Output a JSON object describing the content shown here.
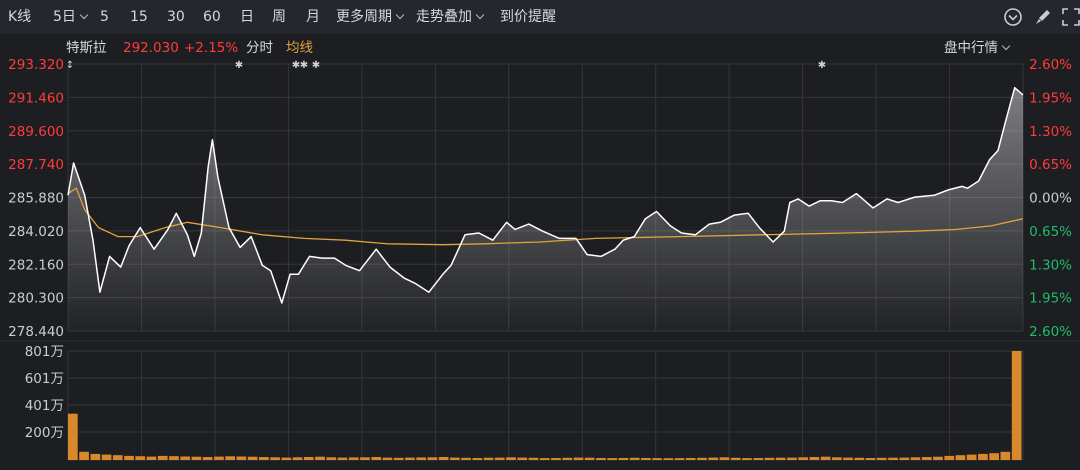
{
  "toolbar": {
    "items": [
      "K线",
      "5日",
      "5",
      "15",
      "30",
      "60",
      "日",
      "周",
      "月",
      "更多周期",
      "走势叠加",
      "到价提醒"
    ]
  },
  "info": {
    "name": "特斯拉",
    "price": "292.030",
    "change": "+2.15%",
    "mode": "分时",
    "avg_label": "均线",
    "right_menu": "盘中行情"
  },
  "colors": {
    "up": "#ff3b3b",
    "down": "#1fbd6a",
    "price_line": "#ffffff",
    "avg_line": "#e3a33c",
    "volume": "#d8892c",
    "grid": "#34363c",
    "text": "#c9ccd3"
  },
  "chart_data": [
    {
      "type": "line",
      "y_ticks": [
        "293.320",
        "291.460",
        "289.600",
        "287.740",
        "285.880",
        "284.020",
        "282.160",
        "280.300",
        "278.440"
      ],
      "pct_ticks": [
        "2.60%",
        "1.95%",
        "1.30%",
        "0.65%",
        "0.00%",
        "0.65%",
        "1.30%",
        "1.95%",
        "2.60%"
      ],
      "ylim": [
        278.44,
        293.32
      ],
      "reference": 285.88,
      "series": [
        {
          "kind": "price",
          "values": [
            286.0,
            287.8,
            286.0,
            283.5,
            280.6,
            282.6,
            282.0,
            283.2,
            284.2,
            283.0,
            284.1,
            285.0,
            283.8,
            282.6,
            283.9,
            287.6,
            289.1,
            287.0,
            284.2,
            283.1,
            283.7,
            282.1,
            281.8,
            280.0,
            281.6,
            281.6,
            282.6,
            282.5,
            282.5,
            282.1,
            281.8,
            283.0,
            282.0,
            281.4,
            281.1,
            280.6,
            281.6,
            282.1,
            283.8,
            283.9,
            283.5,
            284.5,
            284.1,
            284.4,
            284.0,
            283.6,
            283.6,
            282.7,
            282.6,
            283.0,
            283.5,
            283.7,
            284.7,
            285.1,
            284.3,
            283.9,
            283.8,
            284.4,
            284.5,
            284.9,
            285.0,
            284.2,
            283.4,
            284.0,
            285.6,
            285.8,
            285.4,
            285.7,
            285.7,
            285.6,
            286.1,
            285.3,
            285.8,
            285.6,
            285.9,
            286.0,
            286.3,
            286.5,
            286.4,
            286.8,
            288.0,
            288.5,
            290.0,
            292.0,
            291.6
          ],
          "x": [
            0,
            0.4,
            1.2,
            1.8,
            2.3,
            3.0,
            3.8,
            4.4,
            5.2,
            6.2,
            7.2,
            7.8,
            8.6,
            9.1,
            9.6,
            10.1,
            10.4,
            10.8,
            11.6,
            12.4,
            13.2,
            14.0,
            14.6,
            15.4,
            16.0,
            16.6,
            17.4,
            18.3,
            19.2,
            20.0,
            21.0,
            22.2,
            23.2,
            24.2,
            25.0,
            26.0,
            27.0,
            27.6,
            28.6,
            29.6,
            30.6,
            31.6,
            32.2,
            33.2,
            34.2,
            35.4,
            36.6,
            37.4,
            38.4,
            39.4,
            40.0,
            40.8,
            41.6,
            42.4,
            43.4,
            44.2,
            45.2,
            46.2,
            47.0,
            48.0,
            49.0,
            49.8,
            50.8,
            51.6,
            52.0,
            52.6,
            53.4,
            54.2,
            55.0,
            55.8,
            56.8,
            58.0,
            59.0,
            59.8,
            61.0,
            62.4,
            63.4,
            64.4,
            64.8,
            65.6,
            66.4,
            67.0,
            67.5,
            68.2,
            68.8
          ]
        },
        {
          "kind": "average",
          "values": [
            286.1,
            286.4,
            285.2,
            284.2,
            283.7,
            283.7,
            284.2,
            284.5,
            284.2,
            283.8,
            283.6,
            283.5,
            283.3,
            283.25,
            283.3,
            283.4,
            283.6,
            283.7,
            283.8,
            283.9,
            284.0,
            284.1,
            284.3,
            284.7
          ],
          "x": [
            0,
            0.6,
            1.2,
            2.2,
            3.6,
            5.0,
            7.0,
            8.6,
            11.0,
            14.0,
            17.0,
            20.0,
            23.0,
            27.0,
            30.0,
            34.0,
            38.0,
            44.0,
            50.0,
            56.0,
            61.0,
            64.0,
            66.5,
            68.8
          ]
        }
      ]
    },
    {
      "type": "bar",
      "y_ticks": [
        "801万",
        "601万",
        "401万",
        "200万"
      ],
      "ylim": [
        0,
        801
      ],
      "values": [
        340,
        60,
        45,
        40,
        35,
        30,
        28,
        25,
        30,
        28,
        26,
        24,
        22,
        25,
        27,
        26,
        24,
        22,
        20,
        18,
        20,
        22,
        24,
        20,
        18,
        19,
        20,
        22,
        18,
        16,
        18,
        19,
        20,
        22,
        18,
        16,
        15,
        17,
        18,
        20,
        18,
        16,
        14,
        15,
        16,
        18,
        17,
        15,
        14,
        15,
        16,
        15,
        14,
        13,
        14,
        15,
        16,
        18,
        20,
        16,
        14,
        15,
        16,
        17,
        18,
        20,
        22,
        24,
        20,
        18,
        16,
        15,
        16,
        17,
        18,
        20,
        22,
        24,
        30,
        35,
        40,
        45,
        50,
        60,
        801
      ]
    }
  ]
}
